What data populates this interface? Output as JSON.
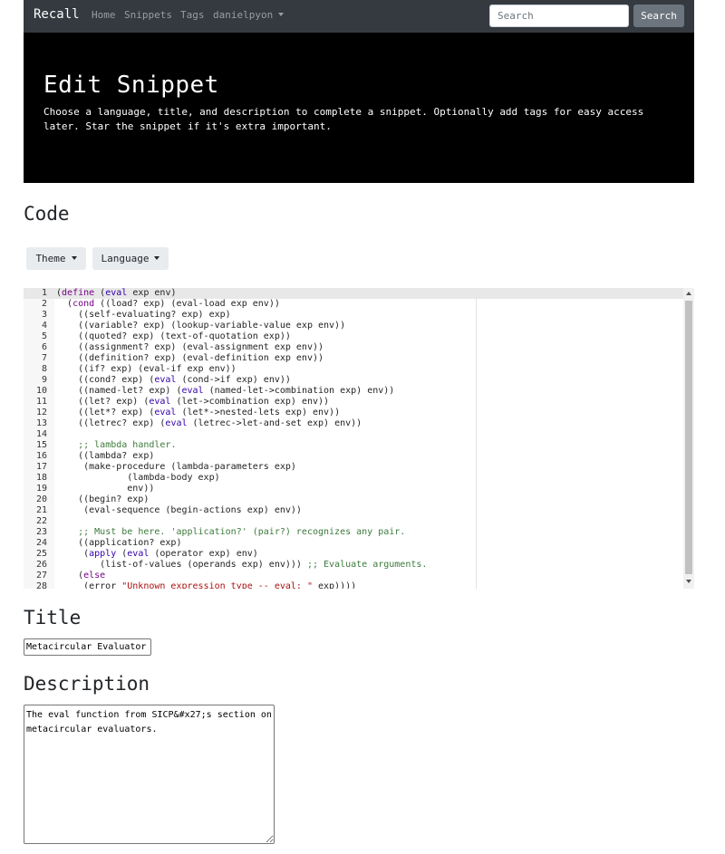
{
  "navbar": {
    "brand": "Recall",
    "links": [
      "Home",
      "Snippets",
      "Tags"
    ],
    "user": "danielpyon",
    "search_placeholder": "Search",
    "search_button": "Search"
  },
  "jumbotron": {
    "title": "Edit Snippet",
    "lead": "Choose a language, title, and description to complete a snippet. Optionally add tags for easy access later. Star the snippet if it's extra important."
  },
  "code_section": {
    "heading": "Code",
    "theme_button": "Theme",
    "language_button": "Language"
  },
  "editor": {
    "lines": [
      {
        "n": "1",
        "t": "(define (eval exp env)"
      },
      {
        "n": "2",
        "t": "  (cond ((load? exp) (eval-load exp env))"
      },
      {
        "n": "3",
        "t": "    ((self-evaluating? exp) exp)"
      },
      {
        "n": "4",
        "t": "    ((variable? exp) (lookup-variable-value exp env))"
      },
      {
        "n": "5",
        "t": "    ((quoted? exp) (text-of-quotation exp))"
      },
      {
        "n": "6",
        "t": "    ((assignment? exp) (eval-assignment exp env))"
      },
      {
        "n": "7",
        "t": "    ((definition? exp) (eval-definition exp env))"
      },
      {
        "n": "8",
        "t": "    ((if? exp) (eval-if exp env))"
      },
      {
        "n": "9",
        "t": "    ((cond? exp) (eval (cond->if exp) env))"
      },
      {
        "n": "10",
        "t": "    ((named-let? exp) (eval (named-let->combination exp) env))"
      },
      {
        "n": "11",
        "t": "    ((let? exp) (eval (let->combination exp) env))"
      },
      {
        "n": "12",
        "t": "    ((let*? exp) (eval (let*->nested-lets exp) env))"
      },
      {
        "n": "13",
        "t": "    ((letrec? exp) (eval (letrec->let-and-set exp) env))"
      },
      {
        "n": "14",
        "t": ""
      },
      {
        "n": "15",
        "t": "    ;; lambda handler."
      },
      {
        "n": "16",
        "t": "    ((lambda? exp)"
      },
      {
        "n": "17",
        "t": "     (make-procedure (lambda-parameters exp)"
      },
      {
        "n": "18",
        "t": "             (lambda-body exp)"
      },
      {
        "n": "19",
        "t": "             env))"
      },
      {
        "n": "20",
        "t": "    ((begin? exp)"
      },
      {
        "n": "21",
        "t": "     (eval-sequence (begin-actions exp) env))"
      },
      {
        "n": "22",
        "t": ""
      },
      {
        "n": "23",
        "t": "    ;; Must be here. 'application?' (pair?) recognizes any pair."
      },
      {
        "n": "24",
        "t": "    ((application? exp)"
      },
      {
        "n": "25",
        "t": "     (apply (eval (operator exp) env)"
      },
      {
        "n": "26",
        "t": "        (list-of-values (operands exp) env))) ;; Evaluate arguments."
      },
      {
        "n": "27",
        "t": "    (else"
      },
      {
        "n": "28",
        "t": "     (error \"Unknown expression type -- eval: \" exp))))"
      }
    ]
  },
  "title_section": {
    "heading": "Title",
    "value": "Metacircular Evaluator"
  },
  "description_section": {
    "heading": "Description",
    "value": "The eval function from SICP&#x27;s section on metacircular evaluators."
  }
}
